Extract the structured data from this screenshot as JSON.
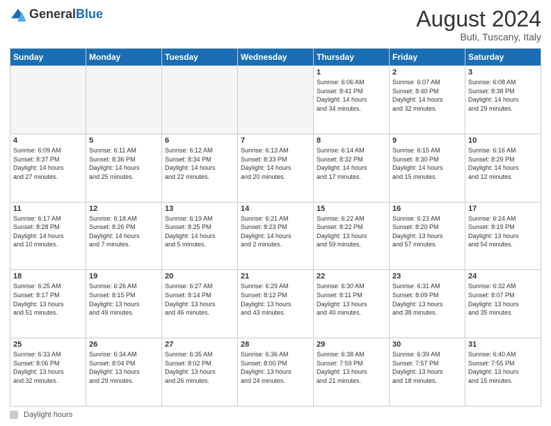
{
  "logo": {
    "general": "General",
    "blue": "Blue"
  },
  "header": {
    "title": "August 2024",
    "subtitle": "Buti, Tuscany, Italy"
  },
  "days_header": [
    "Sunday",
    "Monday",
    "Tuesday",
    "Wednesday",
    "Thursday",
    "Friday",
    "Saturday"
  ],
  "weeks": [
    [
      {
        "day": "",
        "info": ""
      },
      {
        "day": "",
        "info": ""
      },
      {
        "day": "",
        "info": ""
      },
      {
        "day": "",
        "info": ""
      },
      {
        "day": "1",
        "info": "Sunrise: 6:06 AM\nSunset: 8:41 PM\nDaylight: 14 hours\nand 34 minutes."
      },
      {
        "day": "2",
        "info": "Sunrise: 6:07 AM\nSunset: 8:40 PM\nDaylight: 14 hours\nand 32 minutes."
      },
      {
        "day": "3",
        "info": "Sunrise: 6:08 AM\nSunset: 8:38 PM\nDaylight: 14 hours\nand 29 minutes."
      }
    ],
    [
      {
        "day": "4",
        "info": "Sunrise: 6:09 AM\nSunset: 8:37 PM\nDaylight: 14 hours\nand 27 minutes."
      },
      {
        "day": "5",
        "info": "Sunrise: 6:11 AM\nSunset: 8:36 PM\nDaylight: 14 hours\nand 25 minutes."
      },
      {
        "day": "6",
        "info": "Sunrise: 6:12 AM\nSunset: 8:34 PM\nDaylight: 14 hours\nand 22 minutes."
      },
      {
        "day": "7",
        "info": "Sunrise: 6:13 AM\nSunset: 8:33 PM\nDaylight: 14 hours\nand 20 minutes."
      },
      {
        "day": "8",
        "info": "Sunrise: 6:14 AM\nSunset: 8:32 PM\nDaylight: 14 hours\nand 17 minutes."
      },
      {
        "day": "9",
        "info": "Sunrise: 6:15 AM\nSunset: 8:30 PM\nDaylight: 14 hours\nand 15 minutes."
      },
      {
        "day": "10",
        "info": "Sunrise: 6:16 AM\nSunset: 8:29 PM\nDaylight: 14 hours\nand 12 minutes."
      }
    ],
    [
      {
        "day": "11",
        "info": "Sunrise: 6:17 AM\nSunset: 8:28 PM\nDaylight: 14 hours\nand 10 minutes."
      },
      {
        "day": "12",
        "info": "Sunrise: 6:18 AM\nSunset: 8:26 PM\nDaylight: 14 hours\nand 7 minutes."
      },
      {
        "day": "13",
        "info": "Sunrise: 6:19 AM\nSunset: 8:25 PM\nDaylight: 14 hours\nand 5 minutes."
      },
      {
        "day": "14",
        "info": "Sunrise: 6:21 AM\nSunset: 8:23 PM\nDaylight: 14 hours\nand 2 minutes."
      },
      {
        "day": "15",
        "info": "Sunrise: 6:22 AM\nSunset: 8:22 PM\nDaylight: 13 hours\nand 59 minutes."
      },
      {
        "day": "16",
        "info": "Sunrise: 6:23 AM\nSunset: 8:20 PM\nDaylight: 13 hours\nand 57 minutes."
      },
      {
        "day": "17",
        "info": "Sunrise: 6:24 AM\nSunset: 8:19 PM\nDaylight: 13 hours\nand 54 minutes."
      }
    ],
    [
      {
        "day": "18",
        "info": "Sunrise: 6:25 AM\nSunset: 8:17 PM\nDaylight: 13 hours\nand 51 minutes."
      },
      {
        "day": "19",
        "info": "Sunrise: 6:26 AM\nSunset: 8:15 PM\nDaylight: 13 hours\nand 49 minutes."
      },
      {
        "day": "20",
        "info": "Sunrise: 6:27 AM\nSunset: 8:14 PM\nDaylight: 13 hours\nand 46 minutes."
      },
      {
        "day": "21",
        "info": "Sunrise: 6:29 AM\nSunset: 8:12 PM\nDaylight: 13 hours\nand 43 minutes."
      },
      {
        "day": "22",
        "info": "Sunrise: 6:30 AM\nSunset: 8:11 PM\nDaylight: 13 hours\nand 40 minutes."
      },
      {
        "day": "23",
        "info": "Sunrise: 6:31 AM\nSunset: 8:09 PM\nDaylight: 13 hours\nand 38 minutes."
      },
      {
        "day": "24",
        "info": "Sunrise: 6:32 AM\nSunset: 8:07 PM\nDaylight: 13 hours\nand 35 minutes."
      }
    ],
    [
      {
        "day": "25",
        "info": "Sunrise: 6:33 AM\nSunset: 8:06 PM\nDaylight: 13 hours\nand 32 minutes."
      },
      {
        "day": "26",
        "info": "Sunrise: 6:34 AM\nSunset: 8:04 PM\nDaylight: 13 hours\nand 29 minutes."
      },
      {
        "day": "27",
        "info": "Sunrise: 6:35 AM\nSunset: 8:02 PM\nDaylight: 13 hours\nand 26 minutes."
      },
      {
        "day": "28",
        "info": "Sunrise: 6:36 AM\nSunset: 8:00 PM\nDaylight: 13 hours\nand 24 minutes."
      },
      {
        "day": "29",
        "info": "Sunrise: 6:38 AM\nSunset: 7:59 PM\nDaylight: 13 hours\nand 21 minutes."
      },
      {
        "day": "30",
        "info": "Sunrise: 6:39 AM\nSunset: 7:57 PM\nDaylight: 13 hours\nand 18 minutes."
      },
      {
        "day": "31",
        "info": "Sunrise: 6:40 AM\nSunset: 7:55 PM\nDaylight: 13 hours\nand 15 minutes."
      }
    ]
  ],
  "footer": {
    "label": "Daylight hours"
  }
}
